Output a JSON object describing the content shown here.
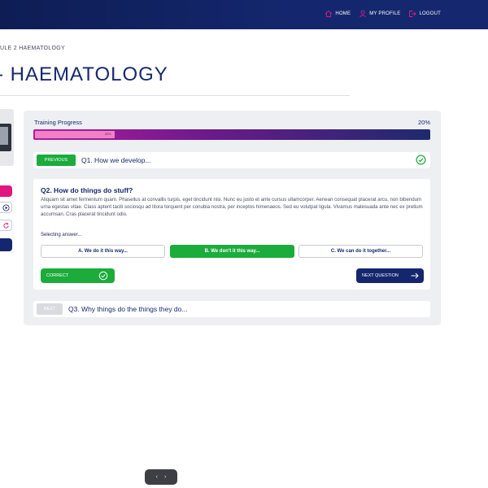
{
  "nav": {
    "home": "HOME",
    "profile": "MY PROFILE",
    "logout": "LOGOUT",
    "accent": "#e3167f"
  },
  "breadcrumb": "ULE 2 HAEMATOLOGY",
  "page_title": "- HAEMATOLOGY",
  "progress": {
    "label": "Training Progress",
    "percent_text": "20%",
    "bar_label": "20%",
    "value": 0.2
  },
  "q1": {
    "button": "PREVIOUS",
    "title": "Q1. How we develop...",
    "status_icon": "check-circle-icon"
  },
  "q2": {
    "title": "Q2. How do things do stuff?",
    "body": "Aliquam sit amet fermentum quam. Phasellus at convallis turpis, eget tincidunt nisi. Nunc eu justo et ante cursus ullamcorper. Aenean consequat placerat arcu, non bibendum urna egestas vitae. Class aptent taciti sociosqu ad litora torquent per conubia nostra, per inceptos himenaeos. Sed eu volutpat ligula. Vivamus malesuada ante nec ex pretium accumsan. Cras placerat tincidunt odio.",
    "selecting": "Selecting answer...",
    "answers": [
      "A. We do it this way...",
      "B. We don't it this way...",
      "C. We can do it together..."
    ],
    "selected_index": 1,
    "correct_label": "CORRECT",
    "next_label": "NEXT QUESTION"
  },
  "q3": {
    "button": "NEXT",
    "title": "Q3. Why things do the things they do..."
  },
  "pager": {
    "prev": "‹",
    "next": "›"
  },
  "colors": {
    "navy": "#14276e",
    "green": "#1bac3b",
    "pink": "#e3167f"
  }
}
